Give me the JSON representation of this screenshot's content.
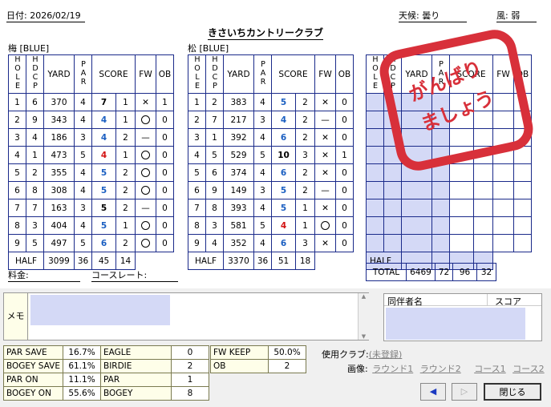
{
  "header": {
    "date": "日付: 2026/02/19",
    "course": "きさいちカントリークラブ",
    "weather": "天候: 曇り",
    "wind": "風: 弱"
  },
  "col_headers": {
    "hole": "HOLE",
    "hdcp": "HDCP",
    "yard": "YARD",
    "par": "PAR",
    "score": "SCORE",
    "fw": "FW",
    "ob": "OB"
  },
  "rounds": [
    {
      "label": "梅 [BLUE]",
      "rows": [
        {
          "hole": "1",
          "hdcp": "6",
          "yard": "370",
          "par": "4",
          "score": "7",
          "color": "black",
          "putts": "1",
          "fw": "✕",
          "ob": "1"
        },
        {
          "hole": "2",
          "hdcp": "9",
          "yard": "343",
          "par": "4",
          "score": "4",
          "color": "blue",
          "putts": "1",
          "fw": "○",
          "ob": "0"
        },
        {
          "hole": "3",
          "hdcp": "4",
          "yard": "186",
          "par": "3",
          "score": "4",
          "color": "blue",
          "putts": "2",
          "fw": "—",
          "ob": "0"
        },
        {
          "hole": "4",
          "hdcp": "1",
          "yard": "473",
          "par": "5",
          "score": "4",
          "color": "red",
          "putts": "1",
          "fw": "○",
          "ob": "0"
        },
        {
          "hole": "5",
          "hdcp": "2",
          "yard": "355",
          "par": "4",
          "score": "5",
          "color": "blue",
          "putts": "2",
          "fw": "○",
          "ob": "0"
        },
        {
          "hole": "6",
          "hdcp": "8",
          "yard": "308",
          "par": "4",
          "score": "5",
          "color": "blue",
          "putts": "2",
          "fw": "○",
          "ob": "0"
        },
        {
          "hole": "7",
          "hdcp": "7",
          "yard": "163",
          "par": "3",
          "score": "5",
          "color": "black",
          "putts": "2",
          "fw": "—",
          "ob": "0"
        },
        {
          "hole": "8",
          "hdcp": "3",
          "yard": "404",
          "par": "4",
          "score": "5",
          "color": "blue",
          "putts": "1",
          "fw": "○",
          "ob": "0"
        },
        {
          "hole": "9",
          "hdcp": "5",
          "yard": "497",
          "par": "5",
          "score": "6",
          "color": "blue",
          "putts": "2",
          "fw": "○",
          "ob": "0"
        }
      ],
      "half": {
        "label": "HALF",
        "yard": "3099",
        "par": "36",
        "score": "45",
        "putts": "14"
      }
    },
    {
      "label": "松 [BLUE]",
      "rows": [
        {
          "hole": "1",
          "hdcp": "2",
          "yard": "383",
          "par": "4",
          "score": "5",
          "color": "blue",
          "putts": "2",
          "fw": "✕",
          "ob": "0"
        },
        {
          "hole": "2",
          "hdcp": "7",
          "yard": "217",
          "par": "3",
          "score": "4",
          "color": "blue",
          "putts": "2",
          "fw": "—",
          "ob": "0"
        },
        {
          "hole": "3",
          "hdcp": "1",
          "yard": "392",
          "par": "4",
          "score": "6",
          "color": "blue",
          "putts": "2",
          "fw": "✕",
          "ob": "0"
        },
        {
          "hole": "4",
          "hdcp": "5",
          "yard": "529",
          "par": "5",
          "score": "10",
          "color": "black",
          "putts": "3",
          "fw": "✕",
          "ob": "1"
        },
        {
          "hole": "5",
          "hdcp": "6",
          "yard": "374",
          "par": "4",
          "score": "6",
          "color": "blue",
          "putts": "2",
          "fw": "✕",
          "ob": "0"
        },
        {
          "hole": "6",
          "hdcp": "9",
          "yard": "149",
          "par": "3",
          "score": "5",
          "color": "blue",
          "putts": "2",
          "fw": "—",
          "ob": "0"
        },
        {
          "hole": "7",
          "hdcp": "8",
          "yard": "393",
          "par": "4",
          "score": "5",
          "color": "blue",
          "putts": "1",
          "fw": "✕",
          "ob": "0"
        },
        {
          "hole": "8",
          "hdcp": "3",
          "yard": "581",
          "par": "5",
          "score": "4",
          "color": "red",
          "putts": "1",
          "fw": "○",
          "ob": "0"
        },
        {
          "hole": "9",
          "hdcp": "4",
          "yard": "352",
          "par": "4",
          "score": "6",
          "color": "blue",
          "putts": "3",
          "fw": "✕",
          "ob": "0"
        }
      ],
      "half": {
        "label": "HALF",
        "yard": "3370",
        "par": "36",
        "score": "51",
        "putts": "18"
      }
    }
  ],
  "third": {
    "half_label": "HALF",
    "total_label": "TOTAL",
    "total_yard": "6469",
    "total_par": "72",
    "total_score": "96",
    "total_putts": "32"
  },
  "stamp": {
    "line1": "がんばり",
    "line2": "ましょう"
  },
  "footer": {
    "fee": "料金:",
    "course_rate": "コースレート:"
  },
  "memo": {
    "label": "メモ"
  },
  "companions": {
    "name_header": "同伴者名",
    "score_header": "スコア"
  },
  "stats1": [
    {
      "label": "PAR SAVE",
      "value": "16.7%"
    },
    {
      "label": "BOGEY SAVE",
      "value": "61.1%"
    },
    {
      "label": "PAR ON",
      "value": "11.1%"
    },
    {
      "label": "BOGEY ON",
      "value": "55.6%"
    }
  ],
  "stats2": [
    {
      "label": "EAGLE",
      "value": "0"
    },
    {
      "label": "BIRDIE",
      "value": "2"
    },
    {
      "label": "PAR",
      "value": "1"
    },
    {
      "label": "BOGEY",
      "value": "8"
    }
  ],
  "stats3": [
    {
      "label": "FW KEEP",
      "value": "50.0%"
    },
    {
      "label": "OB",
      "value": "2"
    }
  ],
  "clubs": {
    "label": "使用クラブ:",
    "value": "(未登録)"
  },
  "images": {
    "label": "画像:",
    "links": [
      "ラウンド1",
      "ラウンド2",
      "コース1",
      "コース2"
    ]
  },
  "buttons": {
    "prev": "◀",
    "next": "▷",
    "close": "閉じる"
  },
  "colors": {
    "blue": "#1b5fc1",
    "red": "#d21212",
    "stamp": "#d8303a",
    "grid": "#1a2a8a",
    "shade": "#d4d9f6"
  }
}
